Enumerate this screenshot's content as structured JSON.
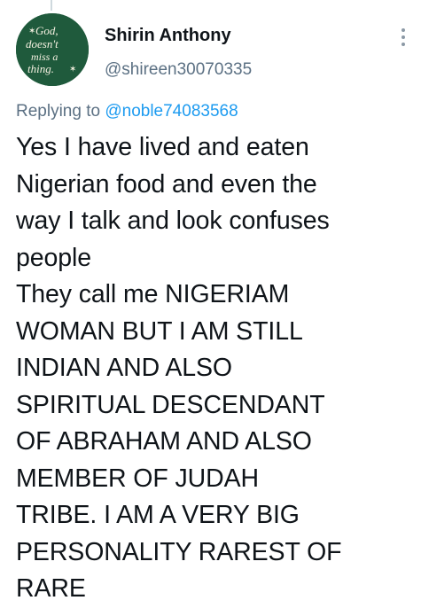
{
  "tweet": {
    "author": {
      "display_name": "Shirin Anthony",
      "handle": "@shireen30070335",
      "avatar_text": [
        "God,",
        "doesn't",
        "miss a",
        "thing."
      ]
    },
    "replying_to": {
      "prefix": "Replying to",
      "mention": "@noble74083568"
    },
    "text_lines": [
      "Yes I have lived and eaten",
      "Nigerian food and even the",
      "way I talk and look confuses",
      "people",
      "They call me NIGERIAM",
      "WOMAN BUT I AM STILL",
      "INDIAN AND ALSO",
      "SPIRITUAL DESCENDANT",
      "OF ABRAHAM AND ALSO",
      "MEMBER OF JUDAH",
      "TRIBE. I AM A VERY BIG",
      "PERSONALITY RAREST OF",
      "RARE"
    ]
  },
  "icons": {
    "more": "more-vertical-icon",
    "avatar": "avatar-image"
  },
  "colors": {
    "text_primary": "#0f1419",
    "text_secondary": "#5b7083",
    "link": "#1d9bf0",
    "avatar_bg": "#1f5a3c",
    "thread_line": "#cfd9de"
  }
}
